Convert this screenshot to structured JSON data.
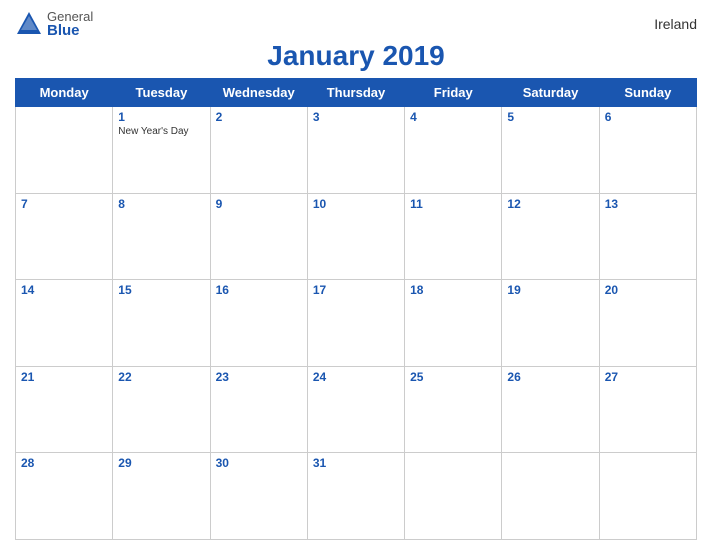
{
  "header": {
    "logo_general": "General",
    "logo_blue": "Blue",
    "title": "January 2019",
    "country": "Ireland"
  },
  "days": [
    "Monday",
    "Tuesday",
    "Wednesday",
    "Thursday",
    "Friday",
    "Saturday",
    "Sunday"
  ],
  "weeks": [
    [
      {
        "num": "",
        "holiday": ""
      },
      {
        "num": "1",
        "holiday": "New Year's Day"
      },
      {
        "num": "2",
        "holiday": ""
      },
      {
        "num": "3",
        "holiday": ""
      },
      {
        "num": "4",
        "holiday": ""
      },
      {
        "num": "5",
        "holiday": ""
      },
      {
        "num": "6",
        "holiday": ""
      }
    ],
    [
      {
        "num": "7",
        "holiday": ""
      },
      {
        "num": "8",
        "holiday": ""
      },
      {
        "num": "9",
        "holiday": ""
      },
      {
        "num": "10",
        "holiday": ""
      },
      {
        "num": "11",
        "holiday": ""
      },
      {
        "num": "12",
        "holiday": ""
      },
      {
        "num": "13",
        "holiday": ""
      }
    ],
    [
      {
        "num": "14",
        "holiday": ""
      },
      {
        "num": "15",
        "holiday": ""
      },
      {
        "num": "16",
        "holiday": ""
      },
      {
        "num": "17",
        "holiday": ""
      },
      {
        "num": "18",
        "holiday": ""
      },
      {
        "num": "19",
        "holiday": ""
      },
      {
        "num": "20",
        "holiday": ""
      }
    ],
    [
      {
        "num": "21",
        "holiday": ""
      },
      {
        "num": "22",
        "holiday": ""
      },
      {
        "num": "23",
        "holiday": ""
      },
      {
        "num": "24",
        "holiday": ""
      },
      {
        "num": "25",
        "holiday": ""
      },
      {
        "num": "26",
        "holiday": ""
      },
      {
        "num": "27",
        "holiday": ""
      }
    ],
    [
      {
        "num": "28",
        "holiday": ""
      },
      {
        "num": "29",
        "holiday": ""
      },
      {
        "num": "30",
        "holiday": ""
      },
      {
        "num": "31",
        "holiday": ""
      },
      {
        "num": "",
        "holiday": ""
      },
      {
        "num": "",
        "holiday": ""
      },
      {
        "num": "",
        "holiday": ""
      }
    ]
  ],
  "colors": {
    "header_bg": "#1a56b0",
    "header_text": "#ffffff",
    "accent": "#1a56b0"
  }
}
